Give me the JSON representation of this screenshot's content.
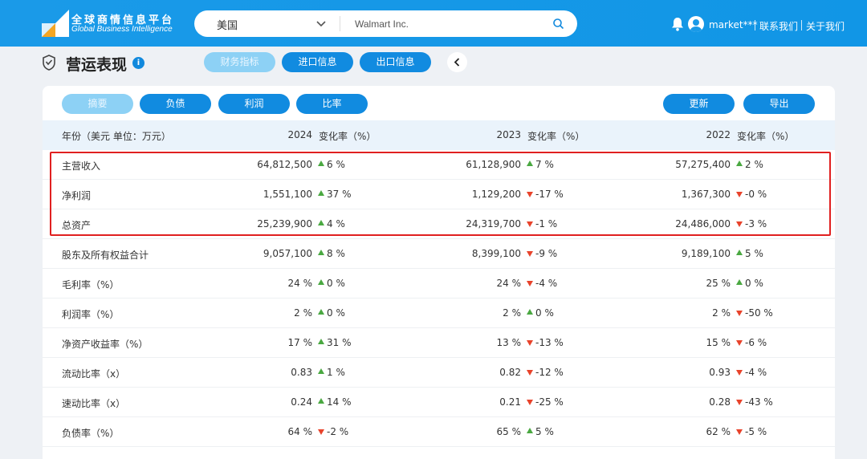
{
  "header": {
    "logo_cn": "全球商情信息平台",
    "logo_en": "Global Business Intelligence",
    "country": "美国",
    "company": "Walmart Inc.",
    "username": "market***",
    "link_contact": "联系我们",
    "link_about": "关于我们"
  },
  "page": {
    "title": "营运表现",
    "info": "i",
    "tabs": [
      "财务指标",
      "进口信息",
      "出口信息"
    ]
  },
  "sub": {
    "tabs": [
      "摘要",
      "负债",
      "利润",
      "比率"
    ],
    "update": "更新",
    "export": "导出"
  },
  "table": {
    "header": {
      "label": "年份（美元 单位：万元）",
      "y2024": "2024",
      "y2023": "2023",
      "y2022": "2022",
      "change": "变化率（%）"
    },
    "rows": [
      {
        "label": "主营收入",
        "v24": "64,812,500",
        "d24": "up",
        "c24": "6 %",
        "v23": "61,128,900",
        "d23": "up",
        "c23": "7 %",
        "v22": "57,275,400",
        "d22": "up",
        "c22": "2 %"
      },
      {
        "label": "净利润",
        "v24": "1,551,100",
        "d24": "up",
        "c24": "37 %",
        "v23": "1,129,200",
        "d23": "down",
        "c23": "-17 %",
        "v22": "1,367,300",
        "d22": "down",
        "c22": "-0 %"
      },
      {
        "label": "总资产",
        "v24": "25,239,900",
        "d24": "up",
        "c24": "4 %",
        "v23": "24,319,700",
        "d23": "down",
        "c23": "-1 %",
        "v22": "24,486,000",
        "d22": "down",
        "c22": "-3 %"
      },
      {
        "label": "股东及所有权益合计",
        "v24": "9,057,100",
        "d24": "up",
        "c24": "8 %",
        "v23": "8,399,100",
        "d23": "down",
        "c23": "-9 %",
        "v22": "9,189,100",
        "d22": "up",
        "c22": "5 %"
      },
      {
        "label": "毛利率（%）",
        "v24": "24 %",
        "d24": "up",
        "c24": "0 %",
        "v23": "24 %",
        "d23": "down",
        "c23": "-4 %",
        "v22": "25 %",
        "d22": "up",
        "c22": "0 %"
      },
      {
        "label": "利润率（%）",
        "v24": "2 %",
        "d24": "up",
        "c24": "0 %",
        "v23": "2 %",
        "d23": "up",
        "c23": "0 %",
        "v22": "2 %",
        "d22": "down",
        "c22": "-50 %"
      },
      {
        "label": "净资产收益率（%）",
        "v24": "17 %",
        "d24": "up",
        "c24": "31 %",
        "v23": "13 %",
        "d23": "down",
        "c23": "-13 %",
        "v22": "15 %",
        "d22": "down",
        "c22": "-6 %"
      },
      {
        "label": "流动比率（x）",
        "v24": "0.83",
        "d24": "up",
        "c24": "1 %",
        "v23": "0.82",
        "d23": "down",
        "c23": "-12 %",
        "v22": "0.93",
        "d22": "down",
        "c22": "-4 %"
      },
      {
        "label": "速动比率（x）",
        "v24": "0.24",
        "d24": "up",
        "c24": "14 %",
        "v23": "0.21",
        "d23": "down",
        "c23": "-25 %",
        "v22": "0.28",
        "d22": "down",
        "c22": "-43 %"
      },
      {
        "label": "负债率（%）",
        "v24": "64 %",
        "d24": "down",
        "c24": "-2 %",
        "v23": "65 %",
        "d23": "up",
        "c23": "5 %",
        "v22": "62 %",
        "d22": "down",
        "c22": "-5 %"
      }
    ]
  },
  "colors": {
    "primary": "#118be0",
    "active_pill": "#8dd1f5",
    "header_bg": "#1a9ae8",
    "up": "#4aa841",
    "down": "#e8432b",
    "highlight": "#e02020"
  }
}
